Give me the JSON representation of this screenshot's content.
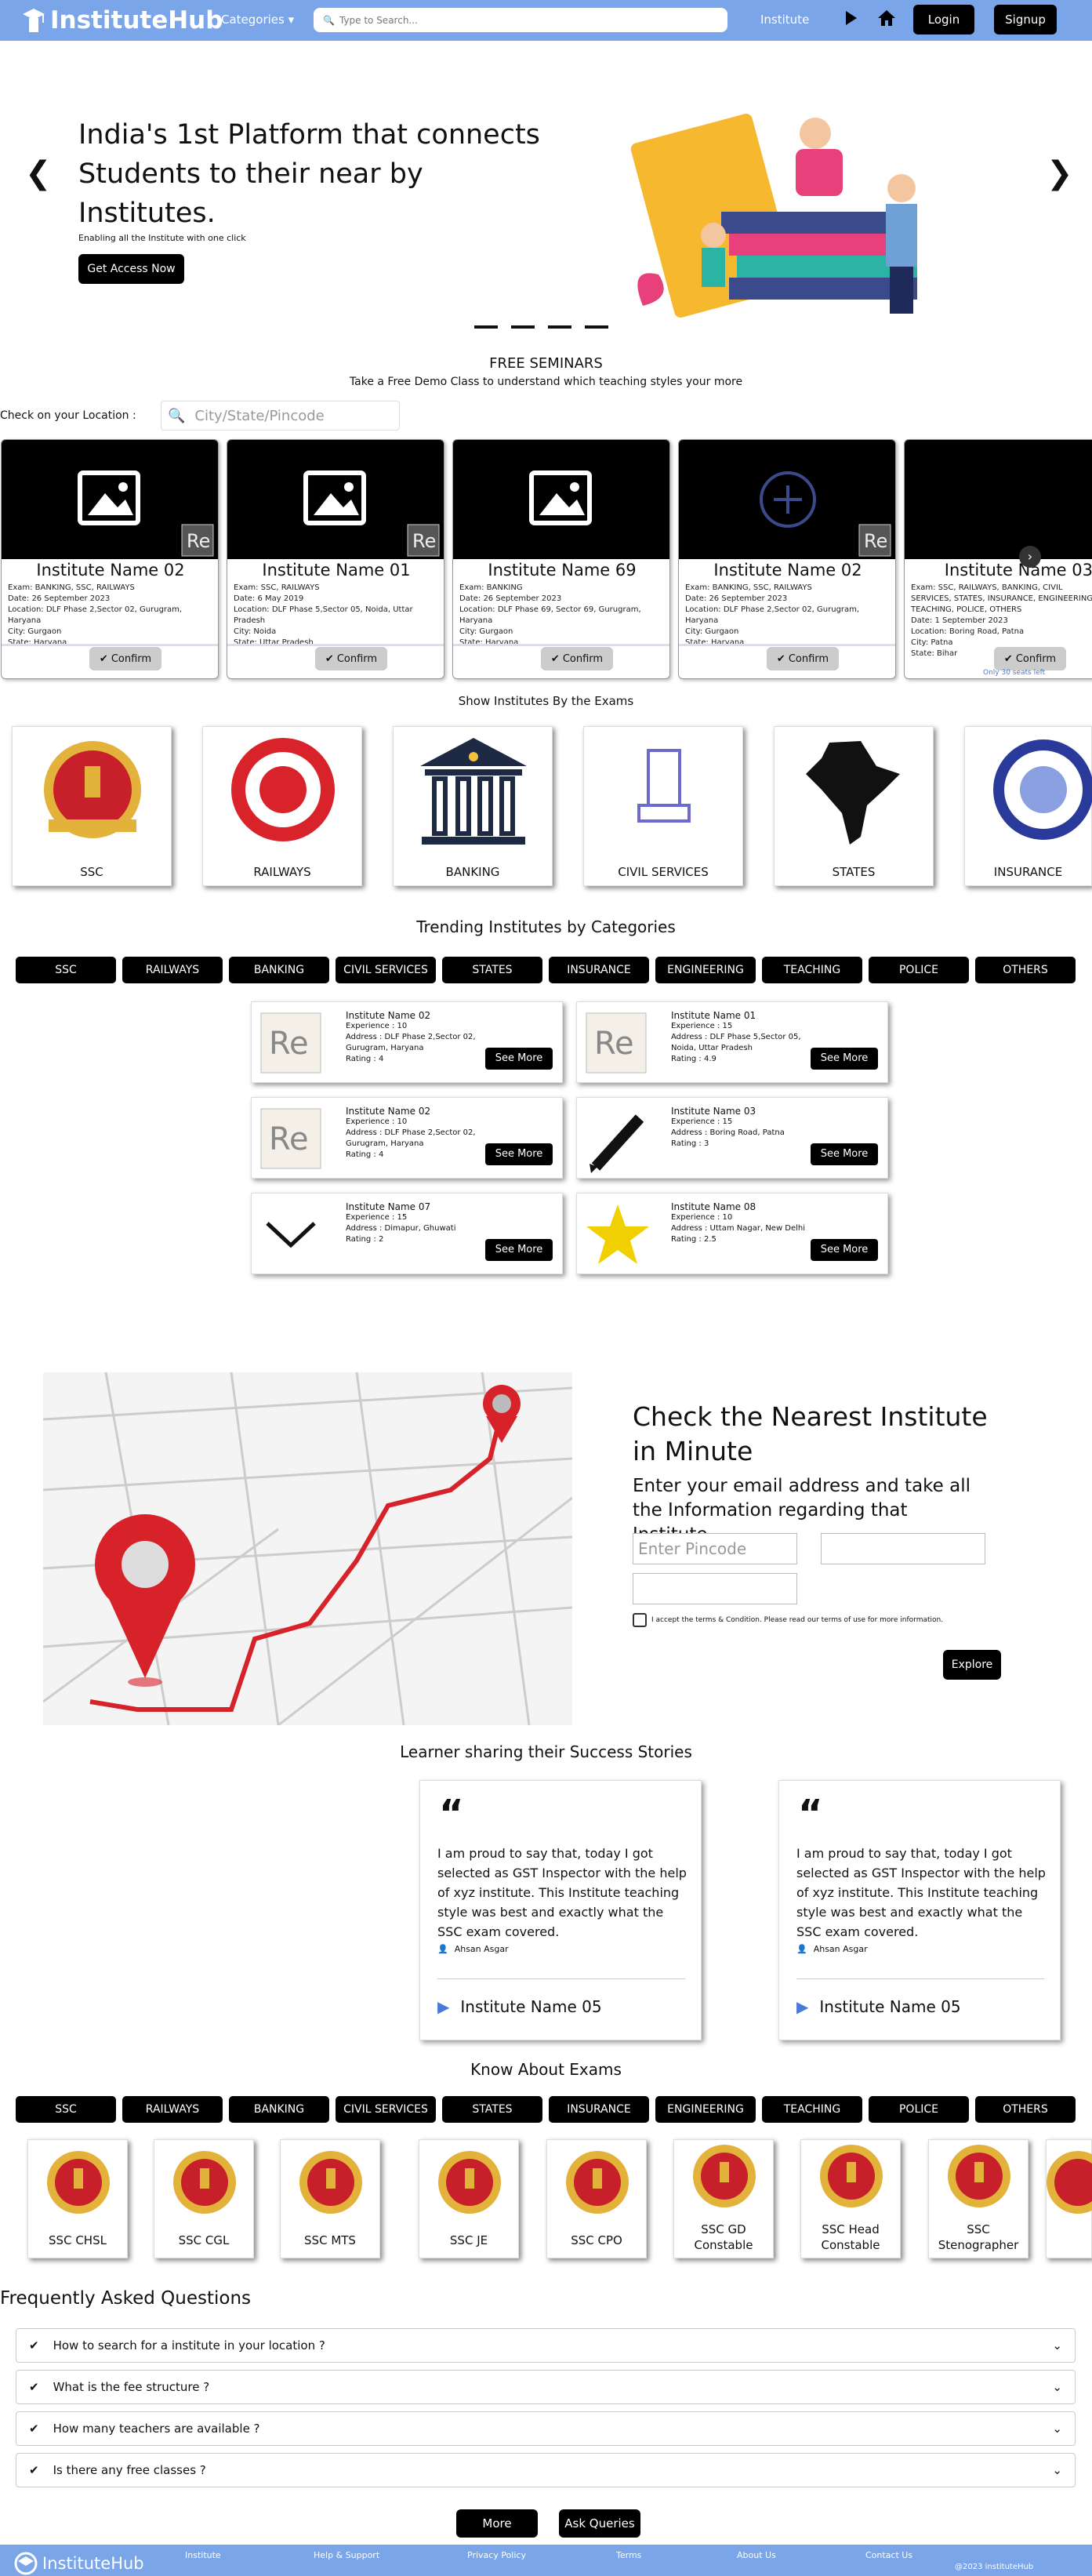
{
  "nav": {
    "brand": "InstituteHub",
    "categories": "Categories",
    "search_placeholder": "Type to Search...",
    "institute_link": "Institute",
    "login": "Login",
    "signup": "Signup"
  },
  "hero": {
    "heading": "India's 1st Platform that connects Students to their near by Institutes.",
    "subtext": "Enabling all the Institute with one click",
    "cta": "Get Access Now",
    "prev": "❮",
    "next": "❯"
  },
  "seminars": {
    "title": "FREE SEMINARS",
    "subtitle": "Take a Free Demo Class to understand which teaching styles your more",
    "location_label": "Check on your Location :",
    "location_placeholder": "City/State/Pincode",
    "cards": [
      {
        "name": "Institute Name 02",
        "exam": "Exam: BANKING, SSC, RAILWAYS",
        "date": "Date: 26 September 2023",
        "location": "Location: DLF Phase 2,Sector 02, Gurugram, Haryana",
        "city": "City: Gurgaon",
        "state": "State: Haryana",
        "confirm": "Confirm"
      },
      {
        "name": "Institute Name 01",
        "exam": "Exam: SSC, RAILWAYS",
        "date": "Date: 6 May 2019",
        "location": "Location: DLF Phase 5,Sector 05, Noida, Uttar Pradesh",
        "city": "City: Noida",
        "state": "State: Uttar Pradesh",
        "confirm": "Confirm"
      },
      {
        "name": "Institute Name 69",
        "exam": "Exam: BANKING",
        "date": "Date: 26 September 2023",
        "location": "Location: DLF Phase 69, Sector 69, Gurugram, Haryana",
        "city": "City: Gurgaon",
        "state": "State: Haryana",
        "confirm": "Confirm"
      },
      {
        "name": "Institute Name 02",
        "exam": "Exam: BANKING, SSC, RAILWAYS",
        "date": "Date: 26 September 2023",
        "location": "Location: DLF Phase 2,Sector 02, Gurugram, Haryana",
        "city": "City: Gurgaon",
        "state": "State: Haryana",
        "confirm": "Confirm"
      },
      {
        "name": "Institute Name 03",
        "exam": "Exam: SSC, RAILWAYS, BANKING, CIVIL SERVICES, STATES, INSURANCE, ENGINEERING, TEACHING, POLICE, OTHERS",
        "date": "Date: 1 September 2023",
        "location": "Location: Boring Road, Patna",
        "city": "City: Patna",
        "state": "State: Bihar",
        "confirm": "Confirm",
        "seats": "Only 30 seats left"
      }
    ]
  },
  "exams_section": {
    "title": "Show Institutes By the Exams",
    "tiles": [
      "SSC",
      "RAILWAYS",
      "BANKING",
      "CIVIL SERVICES",
      "STATES",
      "INSURANCE"
    ]
  },
  "trending": {
    "title": "Trending Institutes by Categories",
    "categories": [
      "SSC",
      "RAILWAYS",
      "BANKING",
      "CIVIL SERVICES",
      "STATES",
      "INSURANCE",
      "ENGINEERING",
      "TEACHING",
      "POLICE",
      "OTHERS"
    ],
    "see_more": "See More",
    "institutes": [
      {
        "name": "Institute Name 02",
        "exp": "Experience : 10",
        "addr": "Address : DLF Phase 2,Sector 02, Gurugram, Haryana",
        "rating": "Rating : 4"
      },
      {
        "name": "Institute Name 01",
        "exp": "Experience : 15",
        "addr": "Address : DLF Phase 5,Sector 05, Noida, Uttar Pradesh",
        "rating": "Rating : 4.9"
      },
      {
        "name": "Institute Name 02",
        "exp": "Experience : 10",
        "addr": "Address : DLF Phase 2,Sector 02, Gurugram, Haryana",
        "rating": "Rating : 4"
      },
      {
        "name": "Institute Name 03",
        "exp": "Experience : 15",
        "addr": "Address : Boring Road, Patna",
        "rating": "Rating : 3"
      },
      {
        "name": "Institute Name 07",
        "exp": "Experience : 15",
        "addr": "Address : Dimapur, Ghuwati",
        "rating": "Rating : 2"
      },
      {
        "name": "Institute Name 08",
        "exp": "Experience : 10",
        "addr": "Address : Uttam Nagar, New Delhi",
        "rating": "Rating : 2.5"
      }
    ]
  },
  "nearest": {
    "title": "Check the Nearest Institute in Minute",
    "subtitle": "Enter your email address and take all the Information regarding that Institute.",
    "pincode_placeholder": "Enter Pincode",
    "terms": "I accept the terms & Condition. Please read our terms of use for more information.",
    "explore": "Explore"
  },
  "stories": {
    "title": "Learner sharing their Success Stories",
    "items": [
      {
        "text": "I am proud to say that, today I got selected as GST Inspector with the help of xyz institute. This Institute teaching style was best and exactly what the SSC exam covered.",
        "author": "Ahsan Asgar",
        "institute": "Institute Name 05"
      },
      {
        "text": "I am proud to say that, today I got selected as GST Inspector with the help of xyz institute. This Institute teaching style was best and exactly what the SSC exam covered.",
        "author": "Ahsan Asgar",
        "institute": "Institute Name 05"
      }
    ]
  },
  "know": {
    "title": "Know About Exams",
    "categories": [
      "SSC",
      "RAILWAYS",
      "BANKING",
      "CIVIL SERVICES",
      "STATES",
      "INSURANCE",
      "ENGINEERING",
      "TEACHING",
      "POLICE",
      "OTHERS"
    ],
    "exams": [
      "SSC CHSL",
      "SSC CGL",
      "SSC MTS",
      "SSC JE",
      "SSC CPO",
      "SSC GD Constable",
      "SSC Head Constable",
      "SSC Stenographer"
    ]
  },
  "faq": {
    "title": "Frequently Asked Questions",
    "items": [
      "How to search for a institute in your location ?",
      "What is the fee structure ?",
      "How many teachers are available ?",
      "Is there any free classes ?"
    ],
    "more": "More",
    "ask": "Ask Queries"
  },
  "footer": {
    "brand": "InstituteHub",
    "links": [
      "Institute",
      "Help & Support",
      "Privacy Policy",
      "Terms",
      "About Us",
      "Contact Us"
    ],
    "copyright": "@2023 instituteHub"
  },
  "colors": {
    "nav_bg": "#7aa5e8",
    "accent": "#000000"
  }
}
